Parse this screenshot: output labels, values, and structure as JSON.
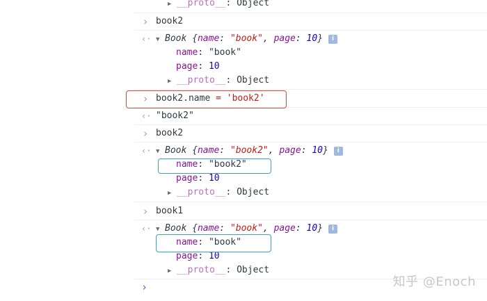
{
  "console": {
    "entries": [
      {
        "kind": "proto_row",
        "proto": "__proto__",
        "sep": ": ",
        "type": "Object"
      },
      {
        "kind": "input",
        "code": "book2"
      },
      {
        "kind": "object_summary",
        "class": "Book",
        "open": " {",
        "k1": "name",
        "c1": ": ",
        "v1": "\"book\"",
        "comma": ", ",
        "k2": "page",
        "c2": ": ",
        "v2": "10",
        "close": "}",
        "info": "i"
      },
      {
        "kind": "prop",
        "key": "name",
        "sep": ": ",
        "value": "\"book\""
      },
      {
        "kind": "prop",
        "key": "page",
        "sep": ": ",
        "value": "10"
      },
      {
        "kind": "proto_row",
        "proto": "__proto__",
        "sep": ": ",
        "type": "Object"
      },
      {
        "kind": "input",
        "code_a": "book2.name ",
        "code_op": "=",
        "code_b": " ",
        "code_str": "'book2'"
      },
      {
        "kind": "output",
        "value": "\"book2\""
      },
      {
        "kind": "input",
        "code": "book2"
      },
      {
        "kind": "object_summary",
        "class": "Book",
        "open": " {",
        "k1": "name",
        "c1": ": ",
        "v1": "\"book2\"",
        "comma": ", ",
        "k2": "page",
        "c2": ": ",
        "v2": "10",
        "close": "}",
        "info": "i"
      },
      {
        "kind": "prop",
        "key": "name",
        "sep": ": ",
        "value": "\"book2\""
      },
      {
        "kind": "prop",
        "key": "page",
        "sep": ": ",
        "value": "10"
      },
      {
        "kind": "proto_row",
        "proto": "__proto__",
        "sep": ": ",
        "type": "Object"
      },
      {
        "kind": "input",
        "code": "book1"
      },
      {
        "kind": "object_summary",
        "class": "Book",
        "open": " {",
        "k1": "name",
        "c1": ": ",
        "v1": "\"book\"",
        "comma": ", ",
        "k2": "page",
        "c2": ": ",
        "v2": "10",
        "close": "}",
        "info": "i"
      },
      {
        "kind": "prop",
        "key": "name",
        "sep": ": ",
        "value": "\"book\""
      },
      {
        "kind": "prop",
        "key": "page",
        "sep": ": ",
        "value": "10"
      },
      {
        "kind": "proto_row",
        "proto": "__proto__",
        "sep": ": ",
        "type": "Object"
      }
    ],
    "gutter": {
      "input_glyph": "›",
      "output_glyph": "‹·",
      "prompt_glyph": "›"
    }
  },
  "watermark": "知乎 @Enoch",
  "colors": {
    "key": "#881391",
    "string": "#c41a16",
    "number": "#1c00cf",
    "highlight_red": "#e0453a",
    "highlight_blue": "#3aa0c8",
    "prompt": "#2a7ae2"
  },
  "icons": {
    "expand": "expand-triangle-icon",
    "collapsed": "collapsed-triangle-icon",
    "info": "info-icon",
    "input_prompt": "chevron-right-icon",
    "output_return": "return-arrow-icon"
  }
}
